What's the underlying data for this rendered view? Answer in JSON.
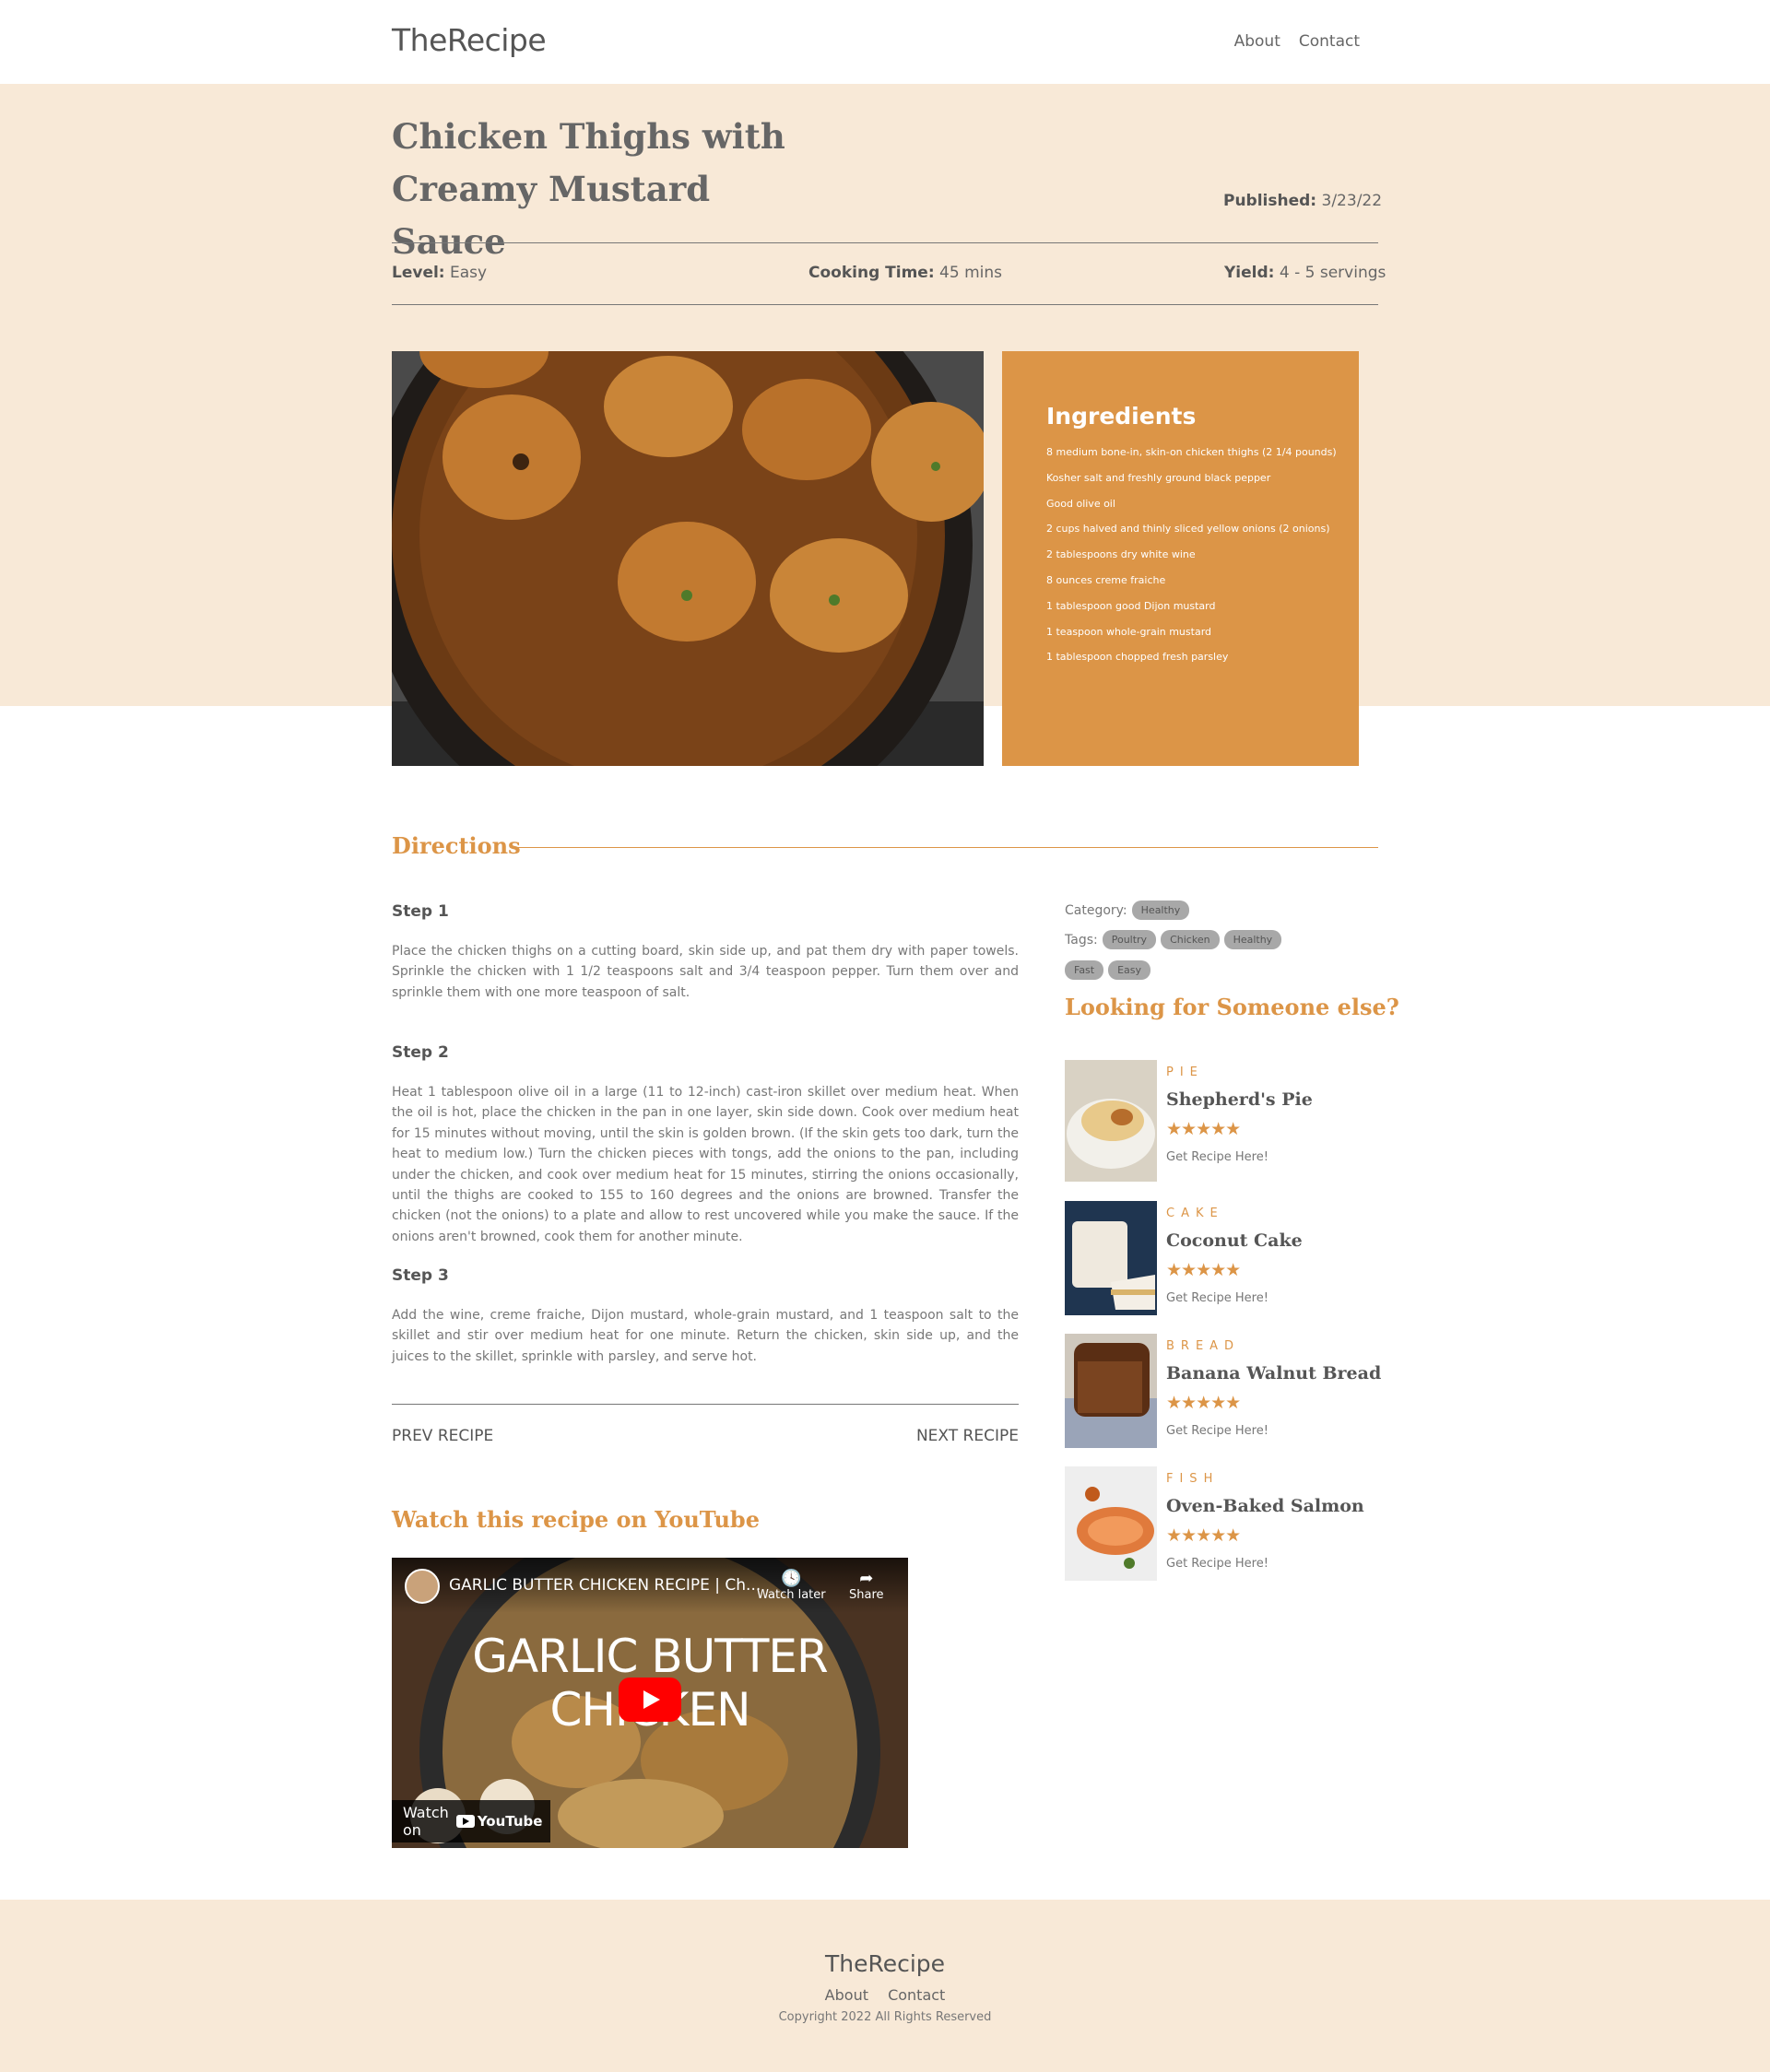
{
  "header": {
    "logo": "TheRecipe",
    "nav": [
      "About",
      "Contact"
    ]
  },
  "recipe": {
    "title": "Chicken Thighs with Creamy Mustard Sauce",
    "published_label": "Published:",
    "published": "3/23/22",
    "level_label": "Level:",
    "level": "Easy",
    "time_label": "Cooking Time:",
    "time": "45 mins",
    "yield_label": "Yield:",
    "yield": "4 - 5 servings"
  },
  "ingredients": {
    "title": "Ingredients",
    "items": [
      "8 medium bone-in, skin-on chicken thighs (2 1/4 pounds)",
      "Kosher salt and freshly ground black pepper",
      "Good olive oil",
      "2 cups halved and thinly sliced yellow onions (2 onions)",
      "2 tablespoons dry white wine",
      "8 ounces creme fraiche",
      "1 tablespoon good Dijon mustard",
      "1 teaspoon whole-grain mustard",
      "1 tablespoon chopped fresh parsley"
    ]
  },
  "directions": {
    "title": "Directions",
    "steps": [
      {
        "title": "Step 1",
        "text": "Place the chicken thighs on a cutting board, skin side up, and pat them dry with paper towels. Sprinkle the chicken with 1 1/2 teaspoons salt and 3/4 teaspoon pepper. Turn them over and sprinkle them with one more teaspoon of salt."
      },
      {
        "title": "Step 2",
        "text": "Heat 1 tablespoon olive oil in a large (11 to 12-inch) cast-iron skillet over medium heat. When the oil is hot, place the chicken in the pan in one layer, skin side down. Cook over medium heat for 15 minutes without moving, until the skin is golden brown. (If the skin gets too dark, turn the heat to medium low.) Turn the chicken pieces with tongs, add the onions to the pan, including under the chicken, and cook over medium heat for 15 minutes, stirring the onions occasionally, until the thighs are cooked to 155 to 160 degrees and the onions are browned. Transfer the chicken (not the onions) to a plate and allow to rest uncovered while you make the sauce. If the onions aren't browned, cook them for another minute."
      },
      {
        "title": "Step 3",
        "text": "Add the wine, creme fraiche, Dijon mustard, whole-grain mustard, and 1 teaspoon salt to the skillet and stir over medium heat for one minute. Return the chicken, skin side up, and the juices to the skillet, sprinkle with parsley, and serve hot."
      }
    ],
    "prev": "PREV RECIPE",
    "next": "NEXT RECIPE"
  },
  "youtube": {
    "title": "Watch this recipe on YouTube",
    "video_title": "GARLIC BUTTER CHICKEN RECIPE | Ch...",
    "watch_later": "Watch later",
    "share": "Share",
    "headline": "GARLIC BUTTER CHICKEN",
    "watch_on": "Watch on",
    "youtube_logo": "YouTube"
  },
  "sidebar": {
    "category_label": "Category:",
    "category": "Healthy",
    "tags_label": "Tags:",
    "tags": [
      "Poultry",
      "Chicken",
      "Healthy",
      "Fast",
      "Easy"
    ],
    "heading": "Looking for Someone else?",
    "cards": [
      {
        "category": "PIE",
        "name": "Shepherd's Pie",
        "stars": "★★★★★",
        "rating": 5,
        "link": "Get Recipe Here!"
      },
      {
        "category": "CAKE",
        "name": "Coconut Cake",
        "stars": "★★★★★",
        "rating": 5,
        "link": "Get Recipe Here!"
      },
      {
        "category": "BREAD",
        "name": "Banana Walnut Bread",
        "stars": "★★★★★",
        "rating": 5,
        "link": "Get Recipe Here!"
      },
      {
        "category": "FISH",
        "name": "Oven-Baked Salmon",
        "stars": "★★★★★",
        "rating": 5,
        "link": "Get Recipe Here!"
      }
    ]
  },
  "footer": {
    "logo": "TheRecipe",
    "nav": [
      "About",
      "Contact"
    ],
    "copyright": "Copyright 2022 All Rights Reserved"
  },
  "colors": {
    "accent": "#dc9547",
    "band": "#f8e9d7",
    "text": "#666666",
    "tag": "#a8a8a8"
  }
}
